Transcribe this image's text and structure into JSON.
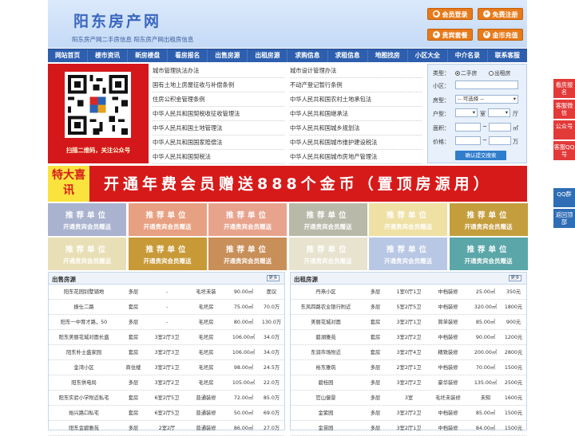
{
  "header": {
    "logo": "阳东房产网",
    "subtitle": "阳东房产网二手房信息   阳东房产网出租房信息",
    "buttons": [
      {
        "label": "会员登录",
        "icon": "user-icon"
      },
      {
        "label": "免费注册",
        "icon": "register-icon"
      },
      {
        "label": "贵宾套餐",
        "icon": "vip-icon"
      },
      {
        "label": "金币充值",
        "icon": "coin-icon"
      }
    ]
  },
  "nav": [
    "网站首页",
    "楼市资讯",
    "新房楼盘",
    "看房报名",
    "出售房源",
    "出租房源",
    "求购信息",
    "求租信息",
    "地图找房",
    "小区大全",
    "中介名录",
    "联系客服"
  ],
  "qr": {
    "caption": "扫描二维码，关注公众号"
  },
  "links": [
    "城市管理执法办法",
    "城市设计管理办法",
    "国有土地上房屋征收与补偿条例",
    "不动产登记暂行条例",
    "住房公积金管理条例",
    "中华人民共和国农村土地承包法",
    "中华人民共和国契税收征收管理法",
    "中华人民共和国继承法",
    "中华人民共和国土地管理法",
    "中华人民共和国城乡规划法",
    "中华人民共和国国家赔偿法",
    "中华人民共和国城市维护建设税法",
    "中华人民共和国契税法",
    "中华人民共和国城市房地产管理法"
  ],
  "search": {
    "type_label": "类型：",
    "type_options": [
      "二手房",
      "出租房"
    ],
    "area_label": "小区：",
    "house_label": "房型：",
    "house_select": "-- 可选择 --",
    "layout_label": "户型：",
    "room_unit": "室",
    "hall_unit": "厅",
    "size_label": "面积：",
    "size_unit": "㎡",
    "price_label": "价格：",
    "price_unit": "万",
    "range_sep": "~",
    "submit": "确认提交搜索"
  },
  "side_tabs": [
    "看房报名",
    "客服微信",
    "公众号",
    "客服QQ号",
    "QQ群",
    "返回顶部"
  ],
  "banner": {
    "tag": "特大喜讯",
    "text": "开通年费会员赠送888个金币（置顶房源用）"
  },
  "tiles": {
    "title": "推荐单位",
    "sub": "开通贵宾会员赠送",
    "colors": [
      "#a9b3cf",
      "#e7a081",
      "#e8a38d",
      "#b9b9a9",
      "#efe0a4",
      "#c49d3d",
      "#e9dfb6",
      "#c79a37",
      "#c88f59",
      "#e7e3cf",
      "#b8c7e4",
      "#5aa6a8"
    ]
  },
  "sale_panel": {
    "title": "出售房源",
    "more": "更多",
    "rows": [
      [
        "阳东花园别墅铺地",
        "多层",
        "-",
        "毛坯未装",
        "90.00㎡",
        "面议"
      ],
      [
        "振仕二路",
        "套房",
        "-",
        "毛坯房",
        "75.00㎡",
        "70.0万"
      ],
      [
        "阳东一中育才路，50",
        "多层",
        "-",
        "毛坯房",
        "80.00㎡",
        "130.0万"
      ],
      [
        "阳东美丽花城对面长盛",
        "套房",
        "3室2厅3卫",
        "毛坯房",
        "106.00㎡",
        "34.0万"
      ],
      [
        "阳东朴士盛家园",
        "套房",
        "3室2厅3卫",
        "毛坯房",
        "106.00㎡",
        "34.0万"
      ],
      [
        "金湾小区",
        "商住楼",
        "3室2厅1卫",
        "毛坯房",
        "98.00㎡",
        "24.5万"
      ],
      [
        "阳东供电局",
        "多层",
        "3室2厅2卫",
        "毛坯房",
        "105.00㎡",
        "22.0万"
      ],
      [
        "阳东实验小学附近私宅",
        "套房",
        "6室2厅5卫",
        "普通装修",
        "72.00㎡",
        "85.0万"
      ],
      [
        "始兴路口私宅",
        "套房",
        "6室2厅5卫",
        "普通装修",
        "50.00㎡",
        "69.0万"
      ],
      [
        "阳东金碧雅苑",
        "多层",
        "2室2厅",
        "普通装修",
        "86.00㎡",
        "27.0万"
      ]
    ]
  },
  "rent_panel": {
    "title": "出租房源",
    "more": "更多",
    "rows": [
      [
        "丹燕小区",
        "多层",
        "1室0厅1卫",
        "中档装修",
        "25.00㎡",
        "350元"
      ],
      [
        "东风四路农业银行附近",
        "多层",
        "5室2厅5卫",
        "中档装修",
        "320.00㎡",
        "1800元"
      ],
      [
        "美丽花城对面",
        "套房",
        "3室2厅1卫",
        "简单装修",
        "85.00㎡",
        "900元"
      ],
      [
        "碧湖雅苑",
        "套房",
        "3室2厅2卫",
        "中档装修",
        "90.00㎡",
        "1200元"
      ],
      [
        "东润市场附近",
        "套房",
        "3室2厅4卫",
        "精致装修",
        "200.00㎡",
        "2800元"
      ],
      [
        "裕东雅筑",
        "多层",
        "2室2厅1卫",
        "中档装修",
        "70.00㎡",
        "1500元"
      ],
      [
        "碧桂园",
        "多层",
        "3室2厅2卫",
        "豪华装修",
        "135.00㎡",
        "2500元"
      ],
      [
        "官山御景",
        "多层",
        "3室",
        "毛坯未装修",
        "未知",
        "1600元"
      ],
      [
        "金紫园",
        "多层",
        "3室2厅2卫",
        "中档装修",
        "85.00㎡",
        "1500元"
      ],
      [
        "金苗园",
        "多层",
        "3室2厅1卫",
        "中档装修",
        "84.00㎡",
        "1500元"
      ]
    ]
  }
}
